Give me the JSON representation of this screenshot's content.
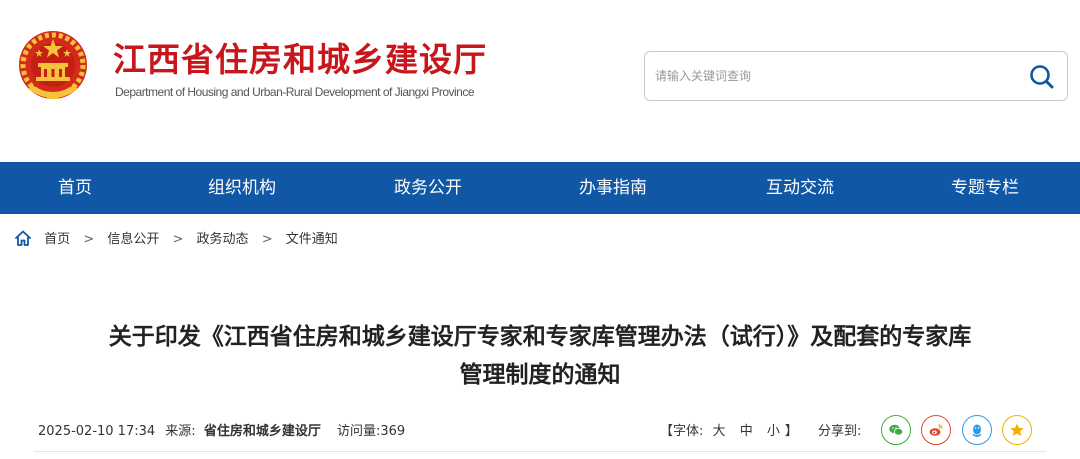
{
  "header": {
    "title": "江西省住房和城乡建设厅",
    "subtitle": "Department of Housing and Urban-Rural Development of Jiangxi Province",
    "logo_icon": "national-emblem-icon",
    "accent_color": "#c8161d"
  },
  "search": {
    "placeholder": "请输入关键词查询",
    "value": "",
    "icon": "search-icon",
    "icon_color": "#1058a5"
  },
  "nav": {
    "background": "#1058a5",
    "items": [
      {
        "label": "首页"
      },
      {
        "label": "组织机构"
      },
      {
        "label": "政务公开"
      },
      {
        "label": "办事指南"
      },
      {
        "label": "互动交流"
      },
      {
        "label": "专题专栏"
      }
    ]
  },
  "breadcrumb": {
    "icon": "home-icon",
    "separator": ">",
    "items": [
      "首页",
      "信息公开",
      "政务动态",
      "文件通知"
    ]
  },
  "article": {
    "title_line1": "关于印发《江西省住房和城乡建设厅专家和专家库管理办法（试行）》及配套的专家库",
    "title_line2": "管理制度的通知",
    "date": "2025-02-10 17:34",
    "source_label": "来源:",
    "source": "省住房和城乡建设厅",
    "visits_label": "访问量:",
    "visits": "369"
  },
  "font_size": {
    "open": "【",
    "label": "字体:",
    "large": "大",
    "medium": "中",
    "small": "小",
    "close": "】"
  },
  "share": {
    "label": "分享到:",
    "buttons": [
      {
        "icon": "wechat-icon",
        "color": "#3dae3b"
      },
      {
        "icon": "weibo-icon",
        "color": "#e6462c"
      },
      {
        "icon": "qq-icon",
        "color": "#2b9be8"
      },
      {
        "icon": "qzone-icon",
        "color": "#f2b000"
      }
    ]
  }
}
